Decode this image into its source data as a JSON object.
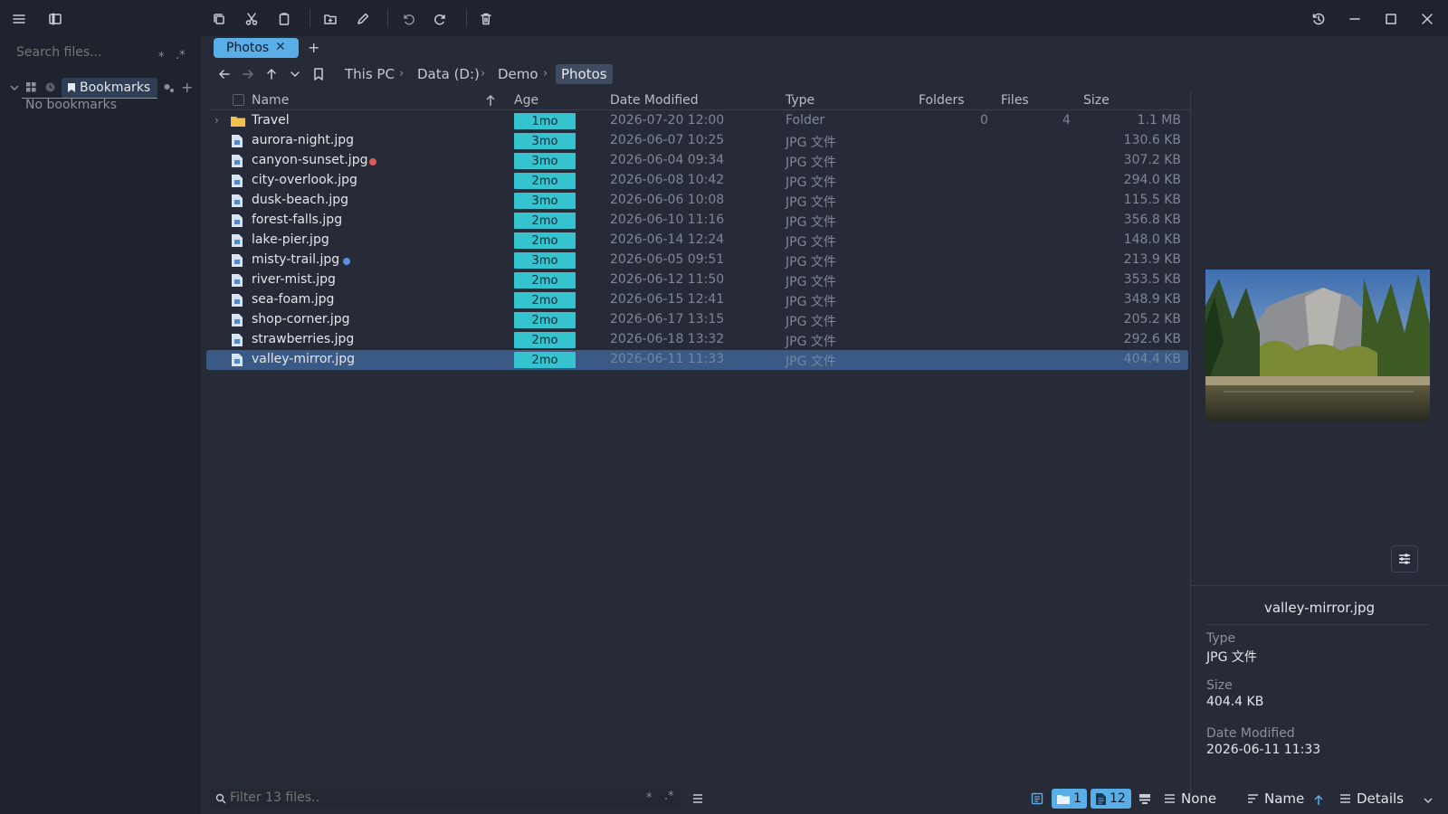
{
  "sidebar": {
    "search_placeholder": "Search files...",
    "search_opts": [
      "*",
      ".*"
    ],
    "bookmarks_label": "Bookmarks",
    "empty_text": "No bookmarks"
  },
  "tabs": [
    {
      "label": "Photos",
      "close": "✕"
    }
  ],
  "new_tab": "+",
  "breadcrumb": [
    "This PC",
    "Data (D:)",
    "Demo",
    "Photos"
  ],
  "columns": {
    "name": "Name",
    "age": "Age",
    "date": "Date Modified",
    "type": "Type",
    "folders": "Folders",
    "files": "Files",
    "size": "Size"
  },
  "rows": [
    {
      "name": "Travel",
      "kind": "folder",
      "age": "1mo",
      "date": "2026-07-20 12:00",
      "type": "Folder",
      "folders": "0",
      "files": "4",
      "size": "1.1 MB"
    },
    {
      "name": "aurora-night.jpg",
      "kind": "file",
      "age": "3mo",
      "date": "2026-06-07 10:25",
      "type": "JPG 文件",
      "size": "130.6 KB"
    },
    {
      "name": "canyon-sunset.jpg",
      "kind": "file",
      "age": "3mo",
      "date": "2026-06-04 09:34",
      "type": "JPG 文件",
      "size": "307.2 KB",
      "tag_color": "#e05a5a"
    },
    {
      "name": "city-overlook.jpg",
      "kind": "file",
      "age": "2mo",
      "date": "2026-06-08 10:42",
      "type": "JPG 文件",
      "size": "294.0 KB"
    },
    {
      "name": "dusk-beach.jpg",
      "kind": "file",
      "age": "3mo",
      "date": "2026-06-06 10:08",
      "type": "JPG 文件",
      "size": "115.5 KB"
    },
    {
      "name": "forest-falls.jpg",
      "kind": "file",
      "age": "2mo",
      "date": "2026-06-10 11:16",
      "type": "JPG 文件",
      "size": "356.8 KB"
    },
    {
      "name": "lake-pier.jpg",
      "kind": "file",
      "age": "2mo",
      "date": "2026-06-14 12:24",
      "type": "JPG 文件",
      "size": "148.0 KB"
    },
    {
      "name": "misty-trail.jpg",
      "kind": "file",
      "age": "3mo",
      "date": "2026-06-05 09:51",
      "type": "JPG 文件",
      "size": "213.9 KB",
      "tag_color": "#5a8ee0"
    },
    {
      "name": "river-mist.jpg",
      "kind": "file",
      "age": "2mo",
      "date": "2026-06-12 11:50",
      "type": "JPG 文件",
      "size": "353.5 KB"
    },
    {
      "name": "sea-foam.jpg",
      "kind": "file",
      "age": "2mo",
      "date": "2026-06-15 12:41",
      "type": "JPG 文件",
      "size": "348.9 KB"
    },
    {
      "name": "shop-corner.jpg",
      "kind": "file",
      "age": "2mo",
      "date": "2026-06-17 13:15",
      "type": "JPG 文件",
      "size": "205.2 KB"
    },
    {
      "name": "strawberries.jpg",
      "kind": "file",
      "age": "2mo",
      "date": "2026-06-18 13:32",
      "type": "JPG 文件",
      "size": "292.6 KB"
    },
    {
      "name": "valley-mirror.jpg",
      "kind": "file",
      "age": "2mo",
      "date": "2026-06-11 11:33",
      "type": "JPG 文件",
      "size": "404.4 KB",
      "selected": true
    }
  ],
  "preview": {
    "filename": "valley-mirror.jpg",
    "type_label": "Type",
    "type_value": "JPG 文件",
    "size_label": "Size",
    "size_value": "404.4 KB",
    "date_label": "Date Modified",
    "date_value": "2026-06-11 11:33"
  },
  "statusbar": {
    "filter_placeholder": "Filter 13 files..",
    "filter_opts": [
      "*",
      ".*"
    ],
    "folder_count": "1",
    "file_count": "12",
    "group_label": "None",
    "sort_label": "Name",
    "view_label": "Details"
  },
  "colors": {
    "accent": "#5aaee8",
    "age_badge": "#34c3cf",
    "selection": "#3a5a85",
    "folder": "#f2c14e"
  }
}
